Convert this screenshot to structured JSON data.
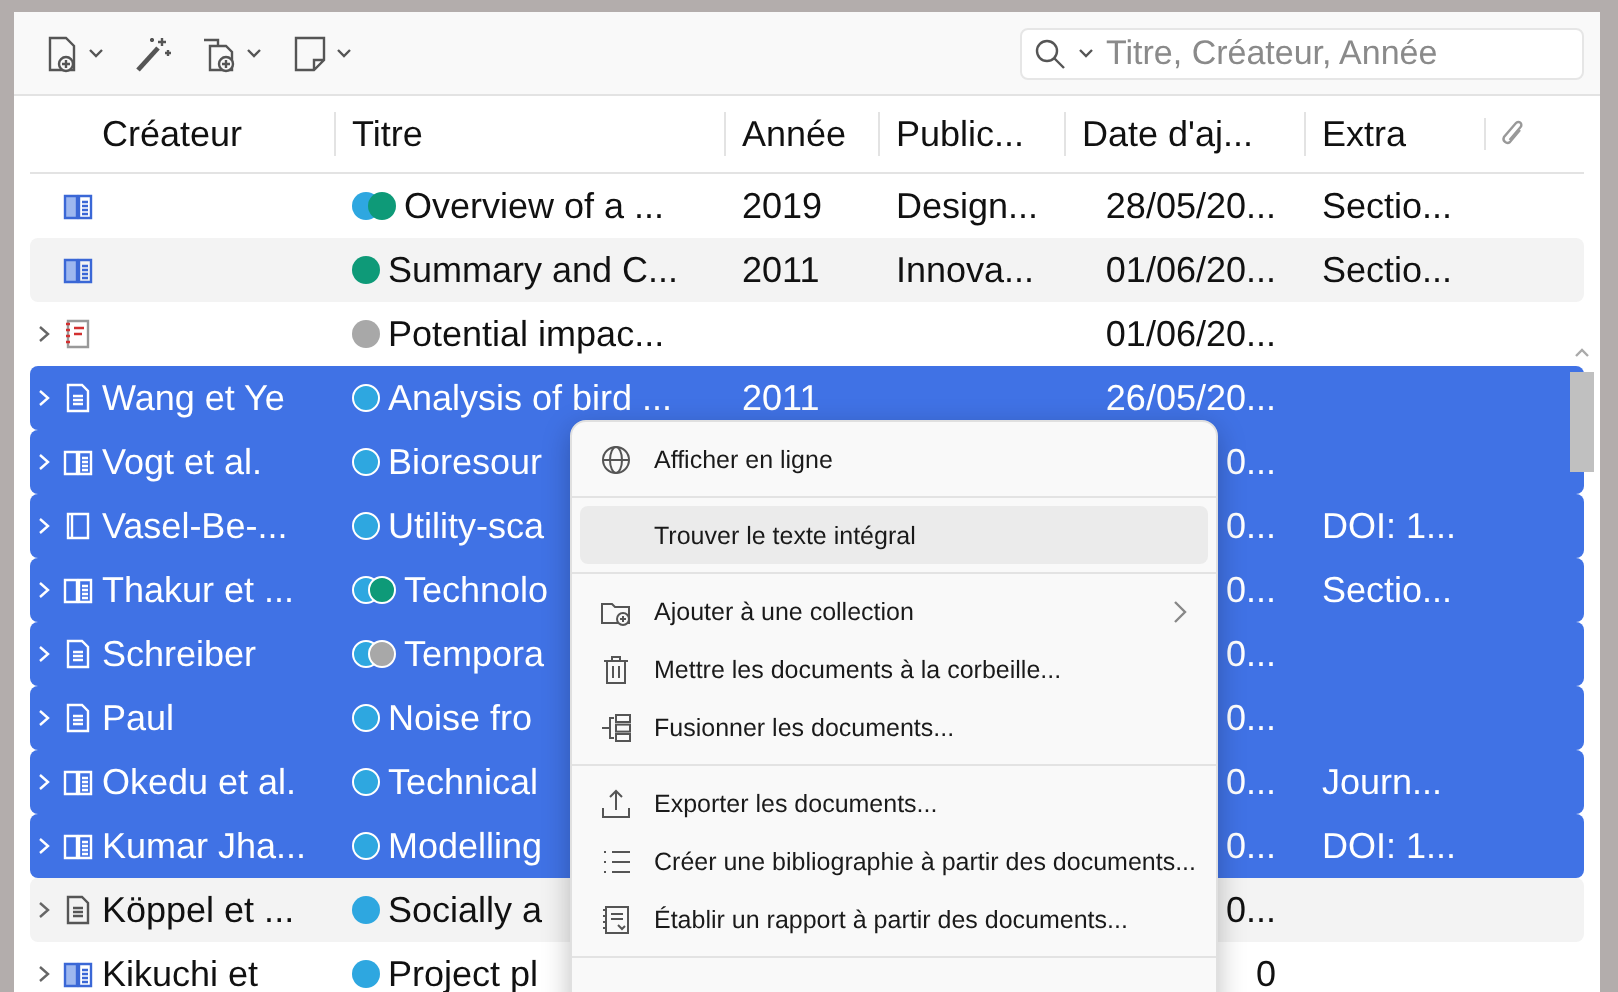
{
  "toolbar": {
    "search": {
      "placeholder": "Titre, Créateur, Année"
    }
  },
  "table": {
    "columns": [
      {
        "label": "Créateur"
      },
      {
        "label": "Titre"
      },
      {
        "label": "Année"
      },
      {
        "label": "Public..."
      },
      {
        "label": "Date d'aj..."
      },
      {
        "label": "Extra"
      }
    ],
    "rows": [
      {
        "kind": "book",
        "has_children": false,
        "selected": false,
        "dots": [
          {
            "color": "#2ea7e0"
          },
          {
            "color": "#0e9a78"
          }
        ],
        "title": "Overview of a ...",
        "year": "2019",
        "publication": "Design...",
        "date": "28/05/20...",
        "extra": "Sectio..."
      },
      {
        "kind": "book",
        "has_children": false,
        "selected": false,
        "dots": [
          {
            "color": "#0e9a78"
          }
        ],
        "title": "Summary and C...",
        "year": "2011",
        "publication": "Innova...",
        "date": "01/06/20...",
        "extra": "Sectio..."
      },
      {
        "kind": "report",
        "has_children": true,
        "selected": false,
        "dots": [
          {
            "color": "#a8a8a8"
          }
        ],
        "title": "Potential impac...",
        "date": "01/06/20..."
      },
      {
        "kind": "document",
        "has_children": true,
        "selected": true,
        "creator": "Wang et Ye",
        "dots": [
          {
            "color": "#2ea7e0"
          }
        ],
        "title": "Analysis of bird ...",
        "year": "2011",
        "date": "26/05/20..."
      },
      {
        "kind": "book",
        "has_children": true,
        "selected": true,
        "creator": "Vogt et al.",
        "dots": [
          {
            "color": "#2ea7e0"
          }
        ],
        "title": "Bioresour",
        "date": "0..."
      },
      {
        "kind": "single-book",
        "has_children": true,
        "selected": true,
        "creator": "Vasel-Be-...",
        "dots": [
          {
            "color": "#2ea7e0"
          }
        ],
        "title": "Utility-sca",
        "date": "0...",
        "extra": "DOI: 1..."
      },
      {
        "kind": "book",
        "has_children": true,
        "selected": true,
        "creator": "Thakur et ...",
        "dots": [
          {
            "color": "#2ea7e0"
          },
          {
            "color": "#0e9a78"
          }
        ],
        "title": "Technolo",
        "date": "0...",
        "extra": "Sectio..."
      },
      {
        "kind": "document",
        "has_children": true,
        "selected": true,
        "creator": "Schreiber",
        "dots": [
          {
            "color": "#2ea7e0"
          },
          {
            "color": "#a8a8a8"
          }
        ],
        "title": "Tempora",
        "date": "0..."
      },
      {
        "kind": "document",
        "has_children": true,
        "selected": true,
        "creator": "Paul",
        "dots": [
          {
            "color": "#2ea7e0"
          }
        ],
        "title": "Noise fro",
        "date": "0..."
      },
      {
        "kind": "book",
        "has_children": true,
        "selected": true,
        "creator": "Okedu et al.",
        "dots": [
          {
            "color": "#2ea7e0"
          }
        ],
        "title": "Technical",
        "date": "0...",
        "extra": "Journ..."
      },
      {
        "kind": "book",
        "has_children": true,
        "selected": true,
        "creator": "Kumar Jha...",
        "dots": [
          {
            "color": "#2ea7e0"
          }
        ],
        "title": "Modelling",
        "date": "0...",
        "extra": "DOI: 1..."
      },
      {
        "kind": "document",
        "has_children": true,
        "selected": false,
        "creator": "Köppel et ...",
        "dots": [
          {
            "color": "#2ea7e0"
          }
        ],
        "title": "Socially a",
        "date": "0..."
      },
      {
        "kind": "book",
        "has_children": true,
        "selected": false,
        "creator": "Kikuchi et",
        "dots": [
          {
            "color": "#2ea7e0"
          }
        ],
        "title": "Project pl",
        "date": "0"
      }
    ]
  },
  "context_menu": {
    "groups": [
      [
        {
          "label": "Afficher en ligne",
          "selected": false,
          "submenu": false
        }
      ],
      [
        {
          "label": "Trouver le texte intégral",
          "selected": true,
          "submenu": false
        }
      ],
      [
        {
          "label": "Ajouter à une collection",
          "selected": false,
          "submenu": true
        },
        {
          "label": "Mettre les documents à la corbeille...",
          "selected": false,
          "submenu": false
        },
        {
          "label": "Fusionner les documents...",
          "selected": false,
          "submenu": false
        }
      ],
      [
        {
          "label": "Exporter les documents...",
          "selected": false,
          "submenu": false
        },
        {
          "label": "Créer une bibliographie à partir des documents...",
          "selected": false,
          "submenu": false
        },
        {
          "label": "Établir un rapport à partir des documents...",
          "selected": false,
          "submenu": false
        }
      ]
    ]
  }
}
